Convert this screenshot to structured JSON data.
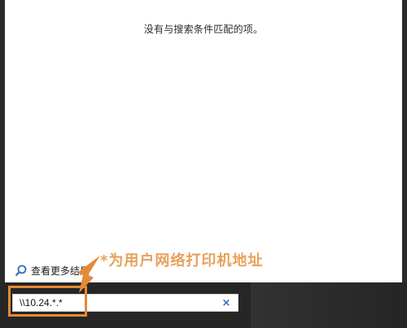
{
  "results": {
    "no_results": "没有与搜索条件匹配的项。",
    "more_results": "查看更多结果"
  },
  "annotation": {
    "text": "*为用户网络打印机地址",
    "color": "#e6a15a"
  },
  "search": {
    "value": "\\\\10.24.*.*",
    "clear_symbol": "×"
  },
  "icons": {
    "search": "search-icon",
    "clear": "close-icon"
  },
  "colors": {
    "highlight": "#e58a36",
    "start_panel": "#ffffff",
    "taskbar_bg": "#262626"
  }
}
